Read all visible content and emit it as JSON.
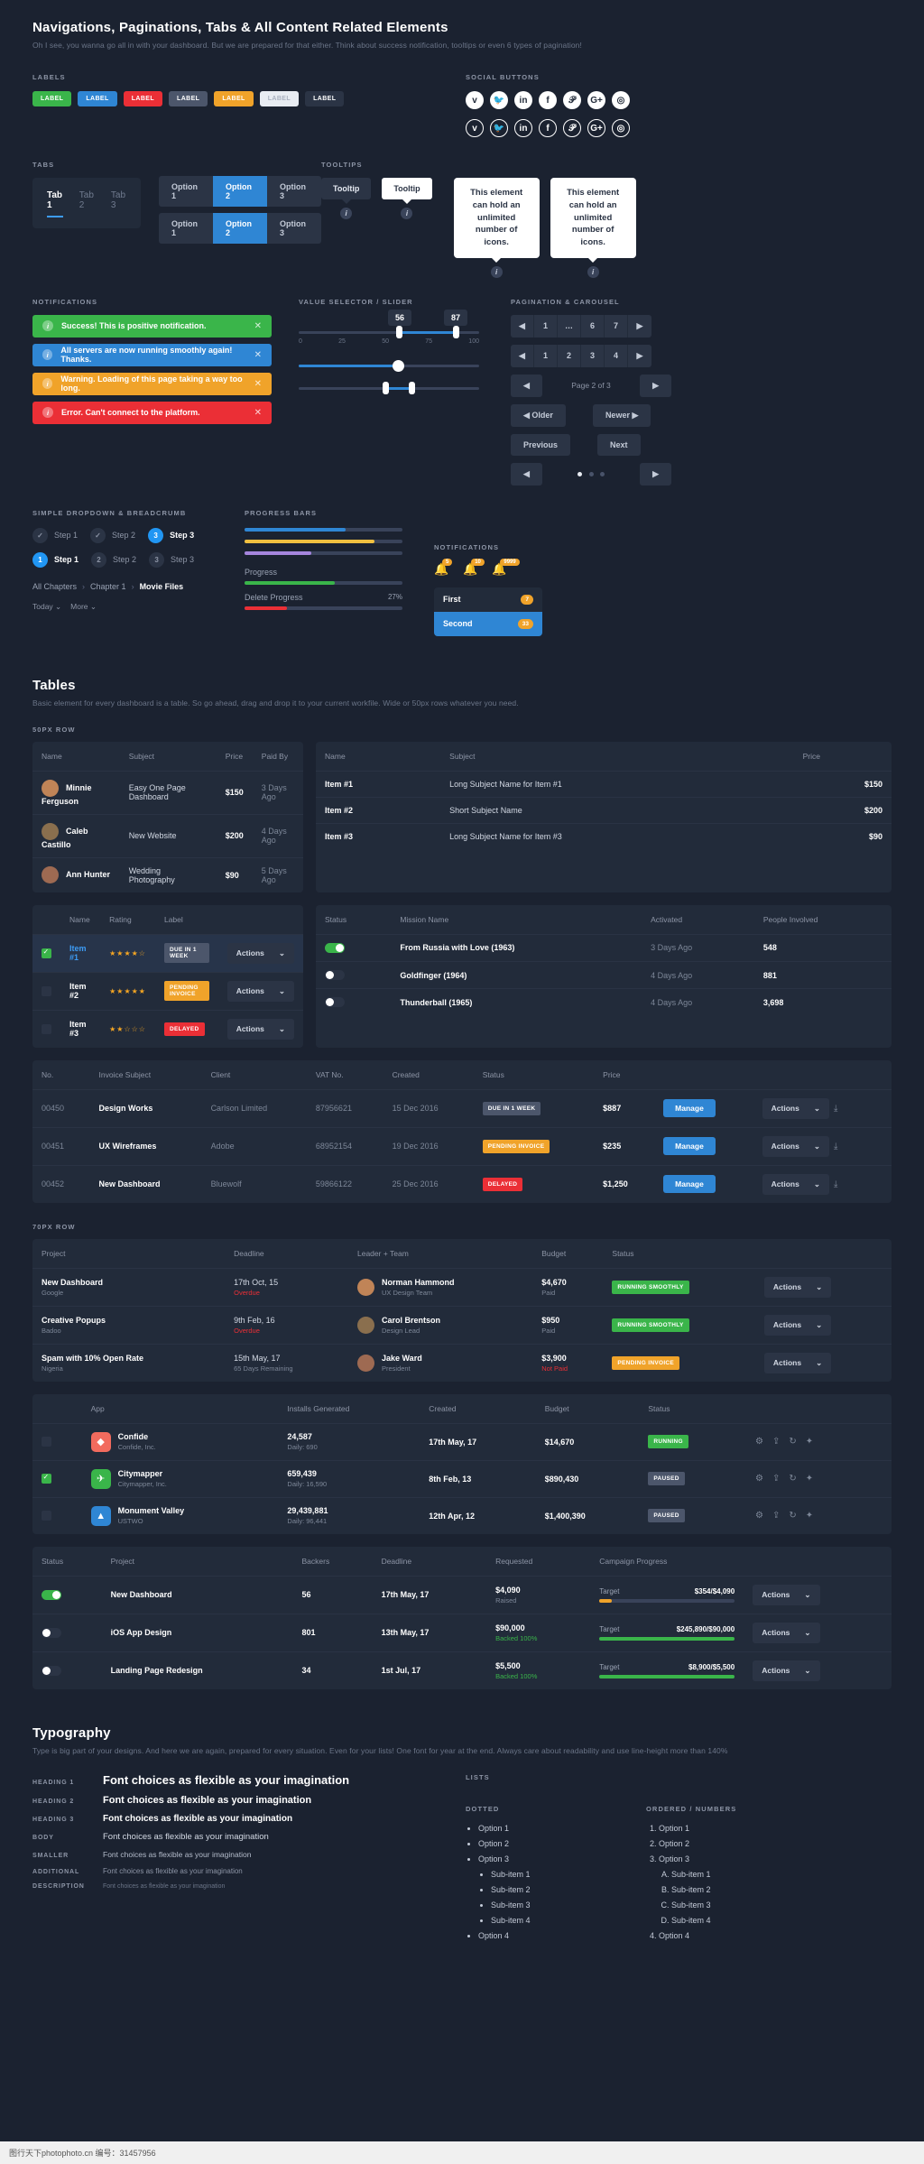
{
  "header": {
    "title": "Navigations, Paginations, Tabs & All Content Related Elements",
    "subtitle": "Oh I see, you wanna go all in with your dashboard. But we are prepared for that either. Think about success notification, tooltips or even 6 types of pagination!"
  },
  "labels": {
    "caption": "LABELS",
    "items": [
      {
        "text": "LABEL",
        "color": "#3ab54a"
      },
      {
        "text": "LABEL",
        "color": "#2f86d4"
      },
      {
        "text": "LABEL",
        "color": "#eb2f36"
      },
      {
        "text": "LABEL",
        "color": "#4c566b"
      },
      {
        "text": "LABEL",
        "color": "#f0a32a"
      },
      {
        "text": "LABEL",
        "color": "#e8ecf2"
      },
      {
        "text": "LABEL",
        "color": "#2b3445"
      }
    ]
  },
  "social": {
    "caption": "SOCIAL BUTTONS",
    "filled": [
      "vimeo-icon",
      "twitter-icon",
      "linkedin-icon",
      "facebook-icon",
      "pinterest-icon",
      "googleplus-icon",
      "instagram-icon"
    ],
    "filled_glyphs": [
      "v",
      "🐦",
      "in",
      "f",
      "𝒫",
      "G+",
      "◎"
    ],
    "outline_glyphs": [
      "v",
      "🐦",
      "in",
      "f",
      "𝒫",
      "G+",
      "◎"
    ]
  },
  "tabs": {
    "caption": "TABS",
    "items": [
      {
        "label": "Tab 1",
        "active": true
      },
      {
        "label": "Tab 2",
        "active": false
      },
      {
        "label": "Tab 3",
        "active": false
      }
    ],
    "option_rows": [
      [
        {
          "label": "Option 1",
          "active": false
        },
        {
          "label": "Option 2",
          "active": true
        },
        {
          "label": "Option 3",
          "active": false
        }
      ],
      [
        {
          "label": "Option 1",
          "active": false
        },
        {
          "label": "Option 2",
          "active": true
        },
        {
          "label": "Option 3",
          "active": false
        }
      ]
    ]
  },
  "tooltips": {
    "caption": "TOOLTIPS",
    "dark": "Tooltip",
    "light": "Tooltip",
    "big1": "This element can hold an unlimited number of icons.",
    "big2": "This element can hold an unlimited number of icons."
  },
  "notifications": {
    "caption": "NOTIFICATIONS",
    "items": [
      {
        "text": "Success! This is positive notification.",
        "color": "#3ab54a"
      },
      {
        "text": "All servers are now running smoothly again! Thanks.",
        "color": "#2f86d4"
      },
      {
        "text": "Warning. Loading of this page taking a way too long.",
        "color": "#f0a32a"
      },
      {
        "text": "Error. Can't connect to the platform.",
        "color": "#eb2f36"
      }
    ]
  },
  "slider": {
    "caption": "VALUE SELECTOR / SLIDER",
    "range_low": "56",
    "range_high": "87",
    "ticks": [
      "0",
      "25",
      "50",
      "75",
      "100"
    ],
    "single_value": 55,
    "range2_low": 48,
    "range2_high": 62
  },
  "pagination": {
    "caption": "PAGINATION & CAROUSEL",
    "row1": [
      "◀",
      "1",
      "…",
      "6",
      "7",
      "▶"
    ],
    "row2": [
      "◀",
      "1",
      "2",
      "3",
      "4",
      "▶"
    ],
    "page_text": "Page 2 of 3",
    "older": "Older",
    "newer": "Newer",
    "previous": "Previous",
    "next": "Next"
  },
  "steps": {
    "caption": "SIMPLE DROPDOWN & BREADCRUMB",
    "row1": [
      {
        "mark": "✓",
        "label": "Step 1",
        "on": false,
        "boldlabel": false
      },
      {
        "mark": "✓",
        "label": "Step 2",
        "on": false,
        "boldlabel": false
      },
      {
        "mark": "3",
        "label": "Step 3",
        "on": true,
        "boldlabel": true
      }
    ],
    "row2": [
      {
        "mark": "1",
        "label": "Step 1",
        "on": true,
        "boldlabel": true
      },
      {
        "mark": "2",
        "label": "Step 2",
        "on": false,
        "boldlabel": false
      },
      {
        "mark": "3",
        "label": "Step 3",
        "on": false,
        "boldlabel": false
      }
    ],
    "breadcrumb": [
      "All Chapters",
      "Chapter 1",
      "Movie Files"
    ],
    "dropdowns": [
      "Today",
      "More"
    ]
  },
  "progress": {
    "caption": "PROGRESS BARS",
    "bars": [
      {
        "pct": 64,
        "color": "#2f86d4"
      },
      {
        "pct": 82,
        "color": "#f0c040"
      },
      {
        "pct": 42,
        "color": "#a585dd"
      }
    ],
    "labeled": [
      {
        "label": "Progress",
        "pct": 57,
        "color": "#3ab54a",
        "value": ""
      },
      {
        "label": "Delete Progress",
        "pct": 27,
        "color": "#eb2f36",
        "value": "27%"
      }
    ]
  },
  "notif_badges": {
    "caption": "NOTIFICATIONS",
    "bells": [
      {
        "icon": "🔔",
        "count": "5",
        "color": "#f0a32a"
      },
      {
        "icon": "🔔",
        "count": "10",
        "color": "#f0a32a"
      },
      {
        "icon": "🔔",
        "count": "9999",
        "color": "#f0a32a"
      }
    ],
    "list": [
      {
        "label": "First",
        "count": "7",
        "color": "#f0a32a"
      },
      {
        "label": "Second",
        "count": "33",
        "color": "#f0a32a"
      }
    ]
  },
  "tables_section": {
    "title": "Tables",
    "subtitle": "Basic element for every dashboard is a table. So go ahead, drag and drop it to your current workfile. Wide or 50px rows whatever you need.",
    "caption_50px": "50PX ROW",
    "caption_70px": "70PX ROW"
  },
  "table1": {
    "columns": [
      "Name",
      "Subject",
      "Price",
      "Paid By"
    ],
    "rows": [
      {
        "avatar": "#c08457",
        "name": "Minnie Ferguson",
        "subject": "Easy One Page Dashboard",
        "price": "$150",
        "paid": "3 Days Ago"
      },
      {
        "avatar": "#8a6f4e",
        "name": "Caleb Castillo",
        "subject": "New Website",
        "price": "$200",
        "paid": "4 Days Ago"
      },
      {
        "avatar": "#9e6a52",
        "name": "Ann Hunter",
        "subject": "Wedding Photography",
        "price": "$90",
        "paid": "5 Days Ago"
      }
    ]
  },
  "table2": {
    "columns": [
      "Name",
      "Subject",
      "Price"
    ],
    "rows": [
      {
        "name": "Item #1",
        "subject": "Long Subject Name for Item #1",
        "price": "$150"
      },
      {
        "name": "Item #2",
        "subject": "Short Subject Name",
        "price": "$200"
      },
      {
        "name": "Item #3",
        "subject": "Long Subject Name for Item #3",
        "price": "$90"
      }
    ]
  },
  "table3": {
    "columns": [
      "",
      "Name",
      "Rating",
      "Label",
      ""
    ],
    "rows": [
      {
        "checked": true,
        "name": "Item #1",
        "stars": 4,
        "badge": "DUE IN 1 WEEK",
        "badge_color": "#4c566b",
        "actions": "Actions",
        "highlight": true
      },
      {
        "checked": false,
        "name": "Item #2",
        "stars": 5,
        "badge": "PENDING INVOICE",
        "badge_color": "#f0a32a",
        "actions": "Actions",
        "highlight": false
      },
      {
        "checked": false,
        "name": "Item #3",
        "stars": 2,
        "badge": "DELAYED",
        "badge_color": "#eb2f36",
        "actions": "Actions",
        "highlight": false
      }
    ]
  },
  "table4": {
    "columns": [
      "Status",
      "Mission Name",
      "Activated",
      "People Involved"
    ],
    "rows": [
      {
        "on": true,
        "mission": "From Russia with Love (1963)",
        "activated": "3 Days Ago",
        "people": "548"
      },
      {
        "on": false,
        "mission": "Goldfinger (1964)",
        "activated": "4 Days Ago",
        "people": "881"
      },
      {
        "on": false,
        "mission": "Thunderball (1965)",
        "activated": "4 Days Ago",
        "people": "3,698"
      }
    ]
  },
  "table5": {
    "columns": [
      "No.",
      "Invoice Subject",
      "Client",
      "VAT No.",
      "Created",
      "Status",
      "Price",
      "",
      ""
    ],
    "rows": [
      {
        "no": "00450",
        "subject": "Design Works",
        "client": "Carlson Limited",
        "vat": "87956621",
        "created": "15 Dec 2016",
        "badge": "DUE IN 1 WEEK",
        "badge_color": "#4c566b",
        "price": "$887",
        "manage": "Manage",
        "actions": "Actions"
      },
      {
        "no": "00451",
        "subject": "UX Wireframes",
        "client": "Adobe",
        "vat": "68952154",
        "created": "19 Dec 2016",
        "badge": "PENDING INVOICE",
        "badge_color": "#f0a32a",
        "price": "$235",
        "manage": "Manage",
        "actions": "Actions"
      },
      {
        "no": "00452",
        "subject": "New Dashboard",
        "client": "Bluewolf",
        "vat": "59866122",
        "created": "25 Dec 2016",
        "badge": "DELAYED",
        "badge_color": "#eb2f36",
        "price": "$1,250",
        "manage": "Manage",
        "actions": "Actions"
      }
    ]
  },
  "table6": {
    "columns": [
      "Project",
      "Deadline",
      "Leader + Team",
      "Budget",
      "Status",
      ""
    ],
    "rows": [
      {
        "project": "New Dashboard",
        "sub": "Google",
        "deadline": "17th Oct, 15",
        "deadline_sub": "Overdue",
        "avatar": "#c08457",
        "leader": "Norman Hammond",
        "leader_sub": "UX Design Team",
        "budget": "$4,670",
        "budget_sub": "Paid",
        "badge": "RUNNING SMOOTHLY",
        "badge_color": "#3ab54a",
        "actions": "Actions"
      },
      {
        "project": "Creative Popups",
        "sub": "Badoo",
        "deadline": "9th Feb, 16",
        "deadline_sub": "Overdue",
        "avatar": "#8a6f4e",
        "leader": "Carol Brentson",
        "leader_sub": "Design Lead",
        "budget": "$950",
        "budget_sub": "Paid",
        "badge": "RUNNING SMOOTHLY",
        "badge_color": "#3ab54a",
        "actions": "Actions"
      },
      {
        "project": "Spam with 10% Open Rate",
        "sub": "Nigeria",
        "deadline": "15th May, 17",
        "deadline_sub": "65 Days Remaining",
        "avatar": "#9e6a52",
        "leader": "Jake Ward",
        "leader_sub": "President",
        "budget": "$3,900",
        "budget_sub": "Not Paid",
        "badge": "PENDING INVOICE",
        "badge_color": "#f0a32a",
        "actions": "Actions"
      }
    ]
  },
  "table7": {
    "columns": [
      "",
      "App",
      "Installs Generated",
      "Created",
      "Budget",
      "Status",
      ""
    ],
    "rows": [
      {
        "checked": false,
        "icon_color": "#f26b5e",
        "icon": "◆",
        "app": "Confide",
        "app_sub": "Confide, Inc.",
        "installs": "24,587",
        "installs_sub": "Daily: 690",
        "created": "17th May, 17",
        "budget": "$14,670",
        "badge": "RUNNING",
        "badge_color": "#3ab54a"
      },
      {
        "checked": true,
        "icon_color": "#3ab54a",
        "icon": "✈",
        "app": "Citymapper",
        "app_sub": "Citymapper, Inc.",
        "installs": "659,439",
        "installs_sub": "Daily: 16,590",
        "created": "8th Feb, 13",
        "budget": "$890,430",
        "badge": "PAUSED",
        "badge_color": "#4c566b"
      },
      {
        "checked": false,
        "icon_color": "#2f86d4",
        "icon": "▲",
        "app": "Monument Valley",
        "app_sub": "USTWO",
        "installs": "29,439,881",
        "installs_sub": "Daily: 96,441",
        "created": "12th Apr, 12",
        "budget": "$1,400,390",
        "badge": "PAUSED",
        "badge_color": "#4c566b"
      }
    ]
  },
  "table8": {
    "columns": [
      "Status",
      "Project",
      "Backers",
      "Deadline",
      "Requested",
      "Campaign Progress",
      ""
    ],
    "rows": [
      {
        "on": true,
        "project": "New Dashboard",
        "backers": "56",
        "deadline": "17th May, 17",
        "requested": "$4,090",
        "requested_sub": "Raised",
        "target_label": "Target",
        "target_value": "$354/$4,090",
        "pct": 9,
        "bar_color": "#f0a32a",
        "actions": "Actions"
      },
      {
        "on": false,
        "project": "iOS App Design",
        "backers": "801",
        "deadline": "13th May, 17",
        "requested": "$90,000",
        "requested_sub": "Backed 100%",
        "target_label": "Target",
        "target_value": "$245,890/$90,000",
        "pct": 100,
        "bar_color": "#3ab54a",
        "actions": "Actions"
      },
      {
        "on": false,
        "project": "Landing Page Redesign",
        "backers": "34",
        "deadline": "1st Jul, 17",
        "requested": "$5,500",
        "requested_sub": "Backed 100%",
        "target_label": "Target",
        "target_value": "$8,900/$5,500",
        "pct": 100,
        "bar_color": "#3ab54a",
        "actions": "Actions"
      }
    ]
  },
  "typography": {
    "title": "Typography",
    "subtitle": "Type is big part of your designs. And here we are again, prepared for every situation. Even for your lists! One font for year at the end. Always care about readability and use line-height more than 140%",
    "rows": [
      {
        "cap": "HEADING 1",
        "text": "Font choices as flexible as your imagination",
        "size": 13,
        "bold": true,
        "color": "#ffffff"
      },
      {
        "cap": "HEADING 2",
        "text": "Font choices as flexible as your imagination",
        "size": 11,
        "bold": true,
        "color": "#ffffff"
      },
      {
        "cap": "HEADING 3",
        "text": "Font choices as flexible as your imagination",
        "size": 10,
        "bold": true,
        "color": "#ffffff"
      },
      {
        "cap": "BODY",
        "text": "Font choices as flexible as your imagination",
        "size": 9.5,
        "bold": false,
        "color": "#d3d9e4"
      },
      {
        "cap": "SMALLER",
        "text": "Font choices as flexible as your imagination",
        "size": 8.5,
        "bold": false,
        "color": "#b4bccb"
      },
      {
        "cap": "ADDITIONAL",
        "text": "Font choices as flexible as your imagination",
        "size": 8,
        "bold": false,
        "color": "#8d95a6"
      },
      {
        "cap": "DESCRIPTION",
        "text": "Font choices as flexible as your imagination",
        "size": 7,
        "bold": false,
        "color": "#6b7588"
      }
    ],
    "lists_caption": "LISTS",
    "dotted_caption": "DOTTED",
    "ordered_caption": "ORDERED / NUMBERS",
    "dotted": [
      "Option 1",
      "Option 2",
      "Option 3"
    ],
    "dotted_sub": [
      "Sub-item 1",
      "Sub-item 2",
      "Sub-item 3",
      "Sub-item 4"
    ],
    "dotted_last": "Option 4",
    "ordered": [
      "Option 1",
      "Option 2",
      "Option 3"
    ],
    "ordered_sub": [
      "Sub-item 1",
      "Sub-item 2",
      "Sub-item 3",
      "Sub-item 4"
    ],
    "ordered_last": "Option 4"
  },
  "footer": {
    "text": "图行天下photophoto.cn   编号：31457956"
  }
}
